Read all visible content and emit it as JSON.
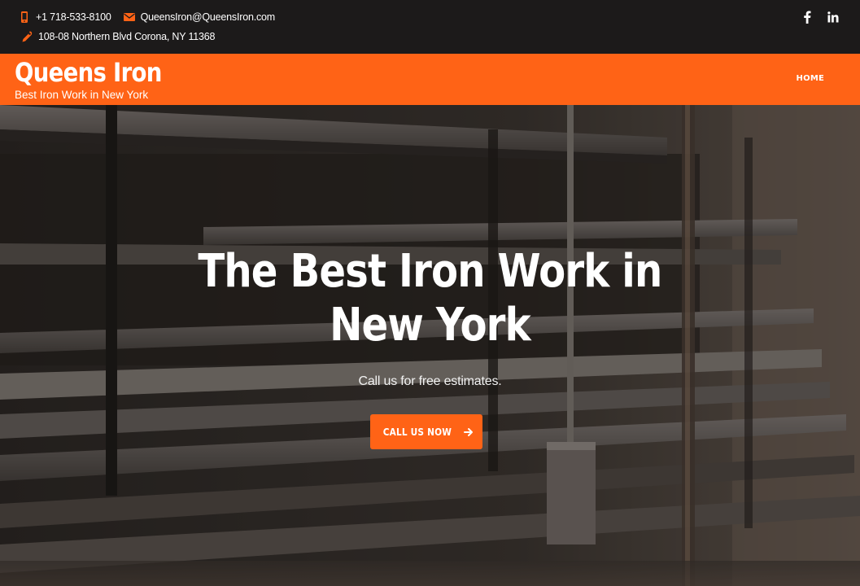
{
  "topbar": {
    "phone": "+1 718-533-8100",
    "email": "QueensIron@QueensIron.com",
    "address": "108-08 Northern Blvd Corona, NY 11368",
    "icons": {
      "phone": "phone-icon",
      "email": "envelope-icon",
      "address": "map-marker-icon"
    },
    "social": [
      "facebook-icon",
      "linkedin-icon"
    ]
  },
  "header": {
    "brand_name": "Queens Iron",
    "tagline": "Best Iron Work in New York",
    "nav": [
      {
        "label": "HOME"
      }
    ]
  },
  "hero": {
    "title_line1": "The Best Iron Work in",
    "title_line2": "New York",
    "subtitle": "Call us for free estimates.",
    "cta_label": "CALL US NOW",
    "cta_icon": "arrow-right-icon"
  },
  "colors": {
    "accent": "#ff6316",
    "topbar_bg": "#1c1a1a",
    "text_light": "#ffffff"
  }
}
